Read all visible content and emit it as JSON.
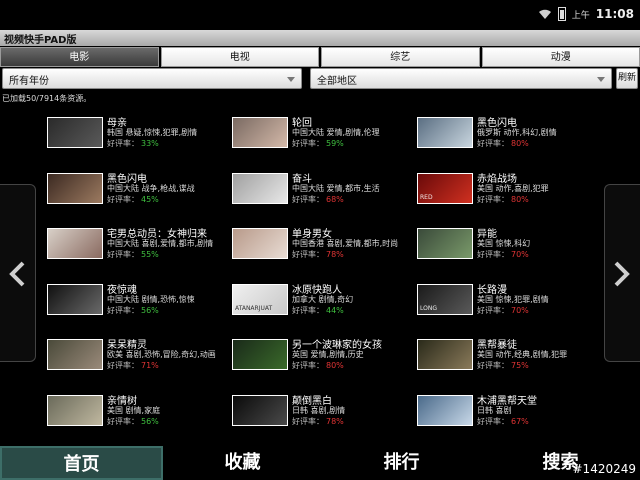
{
  "status": {
    "ampm": "上午",
    "time": "11:08"
  },
  "app": {
    "title": "视频快手PAD版"
  },
  "tabs": [
    {
      "label": "电影",
      "active": true
    },
    {
      "label": "电视",
      "active": false
    },
    {
      "label": "综艺",
      "active": false
    },
    {
      "label": "动漫",
      "active": false
    }
  ],
  "filters": {
    "year": "所有年份",
    "region": "全部地区",
    "refresh": "刷新"
  },
  "count_text": "已加载50/7914条资源。",
  "rating_label": "好评率：",
  "colors": {
    "good": "#3fbf3f",
    "bad": "#e03434",
    "active_nav": "#2a4b47"
  },
  "movies": [
    {
      "title": "母亲",
      "meta": "韩国  悬疑,惊悚,犯罪,剧情",
      "score": "33%",
      "good": true,
      "poster_colors": [
        "#2a2a2a",
        "#5a5a5a"
      ],
      "poster_text": ""
    },
    {
      "title": "轮回",
      "meta": "中国大陆  爱情,剧情,伦理",
      "score": "59%",
      "good": true,
      "poster_colors": [
        "#7a6a62",
        "#d4b9a9"
      ],
      "poster_text": ""
    },
    {
      "title": "黑色闪电",
      "meta": "俄罗斯  动作,科幻,剧情",
      "score": "80%",
      "good": false,
      "poster_colors": [
        "#5a6e82",
        "#c9d6df"
      ],
      "poster_text": ""
    },
    {
      "title": "黑色闪电",
      "meta": "中国大陆  战争,枪战,谍战",
      "score": "45%",
      "good": true,
      "poster_colors": [
        "#3c2a22",
        "#9c7a60"
      ],
      "poster_text": ""
    },
    {
      "title": "奋斗",
      "meta": "中国大陆  爱情,都市,生活",
      "score": "68%",
      "good": false,
      "poster_colors": [
        "#a0a0a0",
        "#e8e8e8"
      ],
      "poster_text": ""
    },
    {
      "title": "赤焰战场",
      "meta": "美国  动作,喜剧,犯罪",
      "score": "80%",
      "good": false,
      "poster_colors": [
        "#6a0a0a",
        "#d03020"
      ],
      "poster_text": "RED"
    },
    {
      "title": "宅男总动员：女神归来",
      "meta": "中国大陆  喜剧,爱情,都市,剧情",
      "score": "55%",
      "good": true,
      "poster_colors": [
        "#d8d0c8",
        "#8a6a60"
      ],
      "poster_text": ""
    },
    {
      "title": "单身男女",
      "meta": "中国香港  喜剧,爱情,都市,时尚",
      "score": "78%",
      "good": false,
      "poster_colors": [
        "#b89a8a",
        "#e8dcd4"
      ],
      "poster_text": ""
    },
    {
      "title": "异能",
      "meta": "美国  惊悚,科幻",
      "score": "70%",
      "good": false,
      "poster_colors": [
        "#3a4a3a",
        "#7a9a6a"
      ],
      "poster_text": ""
    },
    {
      "title": "夜惊魂",
      "meta": "中国大陆  剧情,恐怖,惊悚",
      "score": "56%",
      "good": true,
      "poster_colors": [
        "#101010",
        "#6a6a6a"
      ],
      "poster_text": ""
    },
    {
      "title": "冰原快跑人",
      "meta": "加拿大  剧情,奇幻",
      "score": "44%",
      "good": true,
      "poster_colors": [
        "#f0f0f0",
        "#c8c8c8"
      ],
      "poster_text": "ATANARJUAT"
    },
    {
      "title": "长路漫",
      "meta": "美国  惊悚,犯罪,剧情",
      "score": "70%",
      "good": false,
      "poster_colors": [
        "#1a1a1a",
        "#5a5a5a"
      ],
      "poster_text": "LONG"
    },
    {
      "title": "呆呆精灵",
      "meta": "欧美  喜剧,恐怖,冒险,奇幻,动画",
      "score": "71%",
      "good": false,
      "poster_colors": [
        "#4a4a3a",
        "#9a8a7a"
      ],
      "poster_text": ""
    },
    {
      "title": "另一个波琳家的女孩",
      "meta": "英国  爱情,剧情,历史",
      "score": "80%",
      "good": false,
      "poster_colors": [
        "#1a2a1a",
        "#3a6a2a"
      ],
      "poster_text": ""
    },
    {
      "title": "黑帮暴徒",
      "meta": "美国  动作,经典,剧情,犯罪",
      "score": "75%",
      "good": false,
      "poster_colors": [
        "#2a2a1a",
        "#8a7a5a"
      ],
      "poster_text": ""
    },
    {
      "title": "亲情树",
      "meta": "美国  剧情,家庭",
      "score": "56%",
      "good": true,
      "poster_colors": [
        "#6a6a5a",
        "#c0b8a0"
      ],
      "poster_text": ""
    },
    {
      "title": "颠倒黑白",
      "meta": "日韩  喜剧,剧情",
      "score": "78%",
      "good": false,
      "poster_colors": [
        "#0a0a0a",
        "#4a4a4a"
      ],
      "poster_text": ""
    },
    {
      "title": "木浦黑帮天堂",
      "meta": "日韩  喜剧",
      "score": "67%",
      "good": false,
      "poster_colors": [
        "#4a6a8a",
        "#c8d8e8"
      ],
      "poster_text": ""
    }
  ],
  "bottom_nav": [
    {
      "label": "首页",
      "active": true
    },
    {
      "label": "收藏",
      "active": false
    },
    {
      "label": "排行",
      "active": false
    },
    {
      "label": "搜索",
      "active": false
    }
  ],
  "watermark": "#1420249"
}
